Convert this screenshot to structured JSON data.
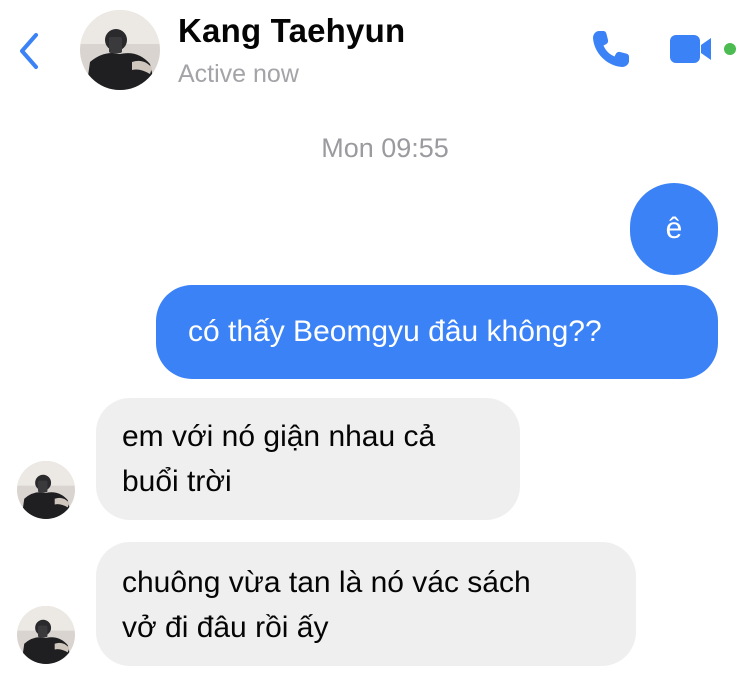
{
  "header": {
    "contact_name": "Kang Taehyun",
    "status": "Active now",
    "accent_color": "#3b82f6",
    "online_color": "#4cbb52"
  },
  "conversation": {
    "timestamp": "Mon 09:55",
    "messages": [
      {
        "direction": "outgoing",
        "text": "ê"
      },
      {
        "direction": "outgoing",
        "text": "có thấy Beomgyu đâu không??"
      },
      {
        "direction": "incoming",
        "text": "em với nó giận nhau cả\nbuổi trời"
      },
      {
        "direction": "incoming",
        "text": "chuông vừa tan là nó vác sách\nvở đi đâu rồi ấy"
      }
    ]
  },
  "icons": {
    "back": "chevron-left-icon",
    "call": "phone-icon",
    "video": "video-camera-icon"
  }
}
